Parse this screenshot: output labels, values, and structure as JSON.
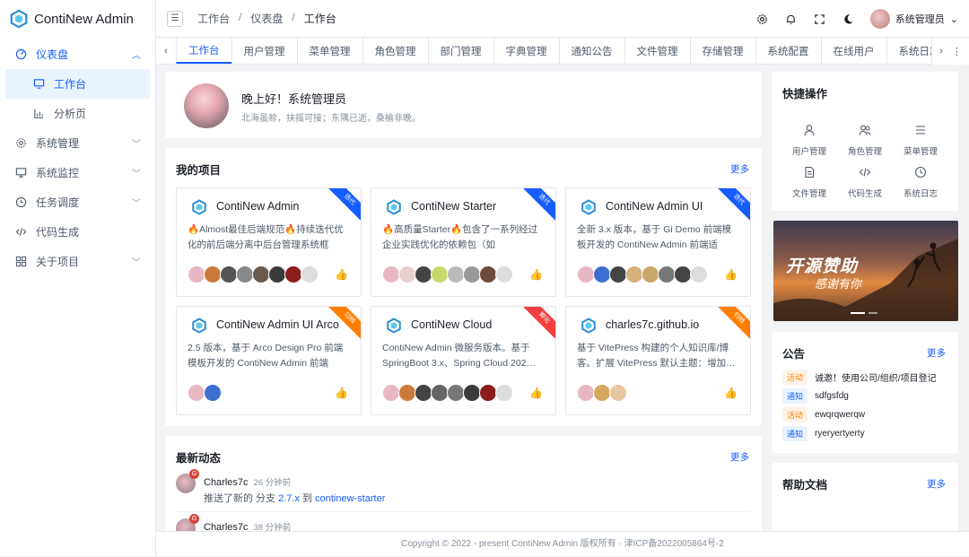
{
  "app": {
    "name": "ContiNew Admin"
  },
  "sidebar": {
    "items": [
      {
        "label": "仪表盘",
        "icon": "dashboard-icon"
      },
      {
        "label": "工作台",
        "icon": "monitor-icon"
      },
      {
        "label": "分析页",
        "icon": "bar-chart-icon"
      },
      {
        "label": "系统管理",
        "icon": "gear-icon"
      },
      {
        "label": "系统监控",
        "icon": "monitor-icon"
      },
      {
        "label": "任务调度",
        "icon": "clock-icon"
      },
      {
        "label": "代码生成",
        "icon": "code-icon"
      },
      {
        "label": "关于项目",
        "icon": "grid-icon"
      }
    ]
  },
  "header": {
    "breadcrumb": [
      "工作台",
      "仪表盘",
      "工作台"
    ],
    "user_name": "系统管理员"
  },
  "tabs": [
    "工作台",
    "用户管理",
    "菜单管理",
    "角色管理",
    "部门管理",
    "字典管理",
    "通知公告",
    "文件管理",
    "存储管理",
    "系统配置",
    "在线用户",
    "系统日志"
  ],
  "greeting": {
    "title": "晚上好！系统管理员",
    "subtitle": "北海虽赊，扶摇可接；东隅已逝，桑榆非晚。"
  },
  "projects": {
    "title": "我的项目",
    "more": "更多",
    "items": [
      {
        "name": "ContiNew Admin",
        "desc": "🔥Almost最佳后端规范🔥持续迭代优化的前后端分离中后台管理系统框架…",
        "ribbon": "迭代",
        "ribbon_color": "#165dff"
      },
      {
        "name": "ContiNew Starter",
        "desc": "🔥高质量Starter🔥包含了一系列经过企业实践优化的依赖包（如 MyBatis-…",
        "ribbon": "迭代",
        "ribbon_color": "#165dff"
      },
      {
        "name": "ContiNew Admin UI",
        "desc": "全新 3.x 版本，基于 Gi Demo 前端模板开发的 ContiNew Admin 前端适配…",
        "ribbon": "迭代",
        "ribbon_color": "#165dff"
      },
      {
        "name": "ContiNew Admin UI Arco",
        "desc": "2.5 版本，基于 Arco Design Pro 前端模板开发的 ContiNew Admin 前端适…",
        "ribbon": "归档",
        "ribbon_color": "#ff7d00"
      },
      {
        "name": "ContiNew Cloud",
        "desc": "ContiNew Admin 微服务版本。基于 SpringBoot 3.x、Spring Cloud 202…",
        "ribbon": "孵化",
        "ribbon_color": "#f53f3f"
      },
      {
        "name": "charles7c.github.io",
        "desc": "基于 VitePress 构建的个人知识库/博客。扩展 VitePress 默认主题：增加…",
        "ribbon": "归档",
        "ribbon_color": "#ff7d00"
      }
    ]
  },
  "dynamics": {
    "title": "最新动态",
    "more": "更多",
    "items": [
      {
        "user": "Charles7c",
        "time": "26 分钟前",
        "text": "推送了新的 分支",
        "branch": "2.7.x",
        "to": "到",
        "repo": "continew-starter",
        "badge": "G"
      },
      {
        "user": "Charles7c",
        "time": "38 分钟前",
        "badge": "G"
      }
    ]
  },
  "quick": {
    "title": "快捷操作",
    "items": [
      {
        "label": "用户管理",
        "icon": "user-icon"
      },
      {
        "label": "角色管理",
        "icon": "users-icon"
      },
      {
        "label": "菜单管理",
        "icon": "menu-icon"
      },
      {
        "label": "文件管理",
        "icon": "file-icon"
      },
      {
        "label": "代码生成",
        "icon": "code-icon"
      },
      {
        "label": "系统日志",
        "icon": "history-icon"
      }
    ]
  },
  "banner": {
    "line1": "开源赞助",
    "line2": "感谢有你"
  },
  "notice": {
    "title": "公告",
    "more": "更多",
    "items": [
      {
        "tag": "活动",
        "type": "act",
        "text": "诚邀！使用公司/组织/项目登记"
      },
      {
        "tag": "通知",
        "type": "ntc",
        "text": "sdfgsfdg"
      },
      {
        "tag": "活动",
        "type": "act",
        "text": "ewqrqwerqw"
      },
      {
        "tag": "通知",
        "type": "ntc",
        "text": "ryeryertyerty"
      }
    ]
  },
  "help": {
    "title": "帮助文档",
    "more": "更多"
  },
  "footer": {
    "text": "Copyright © 2022 - present ContiNew Admin 版权所有 · 津ICP备2022005864号-2"
  },
  "colors": {
    "primary": "#165dff",
    "orange": "#ff7d00",
    "red": "#f53f3f"
  }
}
